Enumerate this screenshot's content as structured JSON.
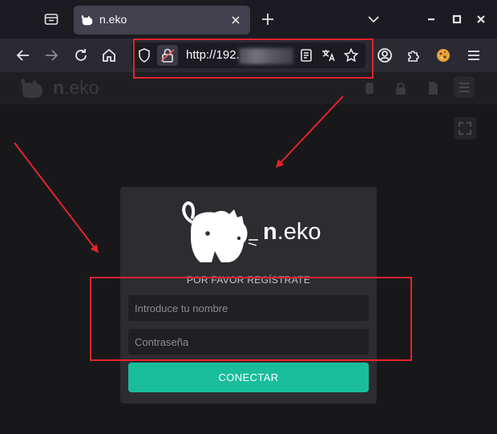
{
  "browser": {
    "tab_title": "n.eko",
    "url": "http://192.",
    "icons": {
      "tab_list": "tab-list-icon",
      "close": "close-icon",
      "new_tab": "plus-icon",
      "back": "back-arrow-icon",
      "forward": "forward-arrow-icon",
      "reload": "reload-icon",
      "home": "home-icon",
      "shield": "shield-icon",
      "lock": "insecure-lock-icon",
      "reader": "reader-view-icon",
      "translate": "translate-icon",
      "bookmark": "star-icon",
      "account": "account-icon",
      "extensions": "puzzle-icon",
      "extension": "cookie-extension-icon",
      "menu": "hamburger-icon"
    }
  },
  "neko": {
    "header_brand_bold": "n",
    "header_brand_rest": ".eko",
    "login": {
      "brand_bold": "n",
      "brand_rest": ".eko",
      "subtitle": "POR FAVOR REGÍSTRATE",
      "name_placeholder": "Introduce tu nombre",
      "password_placeholder": "Contraseña",
      "connect_label": "CONECTAR"
    }
  },
  "colors": {
    "accent": "#19bd9c",
    "annotation": "#e5232b",
    "page_bg": "#18181b",
    "card_bg": "#2d2d31"
  }
}
